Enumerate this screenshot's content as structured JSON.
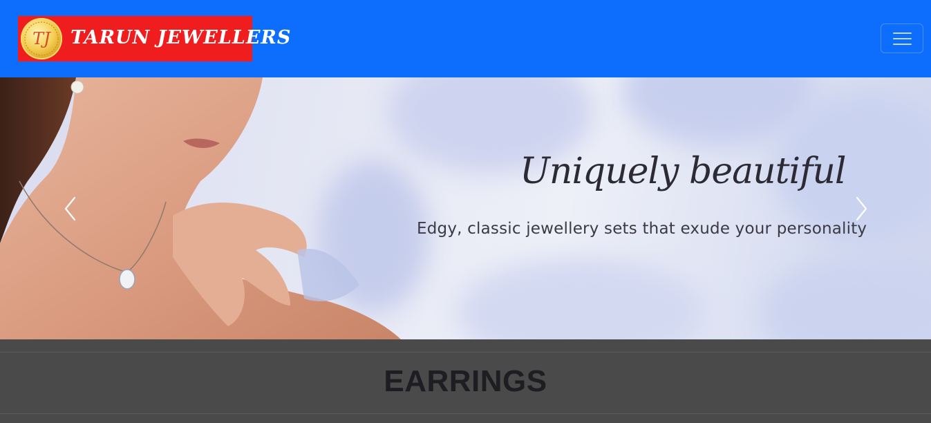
{
  "navbar": {
    "brand_name": "TARUN JEWELLERS",
    "brand_monogram": "TJ",
    "toggler_icon": "hamburger-menu-icon",
    "background_color": "#0d6efd",
    "logo_background_color": "#ef1d1d"
  },
  "carousel": {
    "headline": "Uniquely beautiful",
    "tagline": "Edgy, classic jewellery sets that exude your personality",
    "prev_icon": "chevron-left-icon",
    "next_icon": "chevron-right-icon"
  },
  "section": {
    "title": "EARRINGS",
    "background_color": "#4a4a4a"
  }
}
